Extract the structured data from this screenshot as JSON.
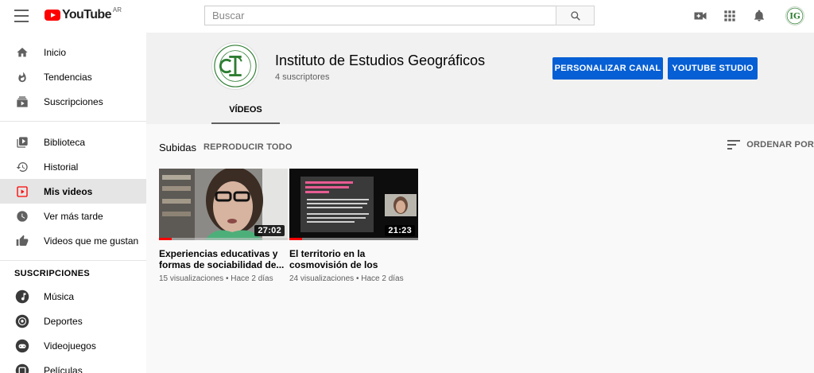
{
  "header": {
    "logo_text": "YouTube",
    "logo_country": "AR",
    "search_placeholder": "Buscar"
  },
  "sidebar": {
    "main_items": [
      {
        "label": "Inicio",
        "icon": "home-icon"
      },
      {
        "label": "Tendencias",
        "icon": "flame-icon"
      },
      {
        "label": "Suscripciones",
        "icon": "subscriptions-icon"
      }
    ],
    "library_items": [
      {
        "label": "Biblioteca",
        "icon": "library-icon"
      },
      {
        "label": "Historial",
        "icon": "history-icon"
      },
      {
        "label": "Mis videos",
        "icon": "my-videos-icon",
        "active": true
      },
      {
        "label": "Ver más tarde",
        "icon": "clock-icon"
      },
      {
        "label": "Videos que me gustan",
        "icon": "thumb-up-icon"
      }
    ],
    "subscriptions_title": "SUSCRIPCIONES",
    "subscription_items": [
      {
        "label": "Música",
        "icon": "music-icon"
      },
      {
        "label": "Deportes",
        "icon": "sports-icon"
      },
      {
        "label": "Videojuegos",
        "icon": "gaming-icon"
      },
      {
        "label": "Películas",
        "icon": "movies-icon"
      }
    ]
  },
  "channel": {
    "name": "Instituto de Estudios Geográficos",
    "subscribers": "4 suscriptores",
    "customize_button": "PERSONALIZAR CANAL",
    "studio_button": "YOUTUBE STUDIO",
    "tabs": [
      {
        "label": "VÍDEOS",
        "active": true
      }
    ]
  },
  "uploads": {
    "title": "Subidas",
    "play_all": "REPRODUCIR TODO",
    "sort_label": "ORDENAR POR",
    "videos": [
      {
        "title": "Experiencias educativas y formas de sociabilidad de...",
        "duration": "27:02",
        "views": "15 visualizaciones",
        "age": "Hace 2 días",
        "progress": 0.1
      },
      {
        "title": "El territorio en la cosmovisión de los pueblos...",
        "duration": "21:23",
        "views": "24 visualizaciones",
        "age": "Hace 2 días",
        "progress": 0.1
      }
    ]
  },
  "colors": {
    "accent_blue": "#065fd4",
    "youtube_red": "#ff0000",
    "logo_green": "#2e7d32"
  }
}
